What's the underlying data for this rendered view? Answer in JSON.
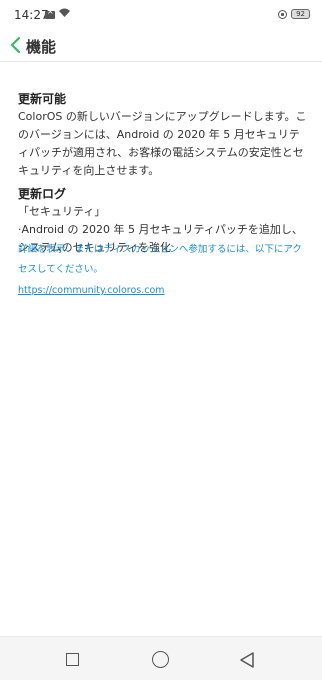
{
  "status_bar": {
    "time": "14:27",
    "battery": "92",
    "icons": [
      "mail-icon",
      "wifi-icon",
      "lock-icon",
      "battery-icon"
    ]
  },
  "header": {
    "title": "機能",
    "back_icon": "chevron-left-icon",
    "accent_color": "#35b86b"
  },
  "sections": [
    {
      "title": "更新可能",
      "body": "ColorOS の新しいバージョンにアップグレードします。このバージョンには、Android の 2020 年 5 月セキュリティパッチが適用され、お客様の電話システムの安定性とセキュリティを向上させます。"
    },
    {
      "title": "更新ログ",
      "lines": [
        "「セキュリティ」",
        "·Android の 2020 年 5 月セキュリティパッチを追加し、システムのセキュリティを強化"
      ]
    }
  ],
  "note": {
    "text": "詳細を表示、またはディスカッションへ参加するには、以下にアクセスしてください。",
    "link": "https://community.coloros.com",
    "color": "#1b8fcf"
  },
  "nav_bar": {
    "icons": [
      "recent-apps-icon",
      "home-icon",
      "back-icon"
    ]
  }
}
